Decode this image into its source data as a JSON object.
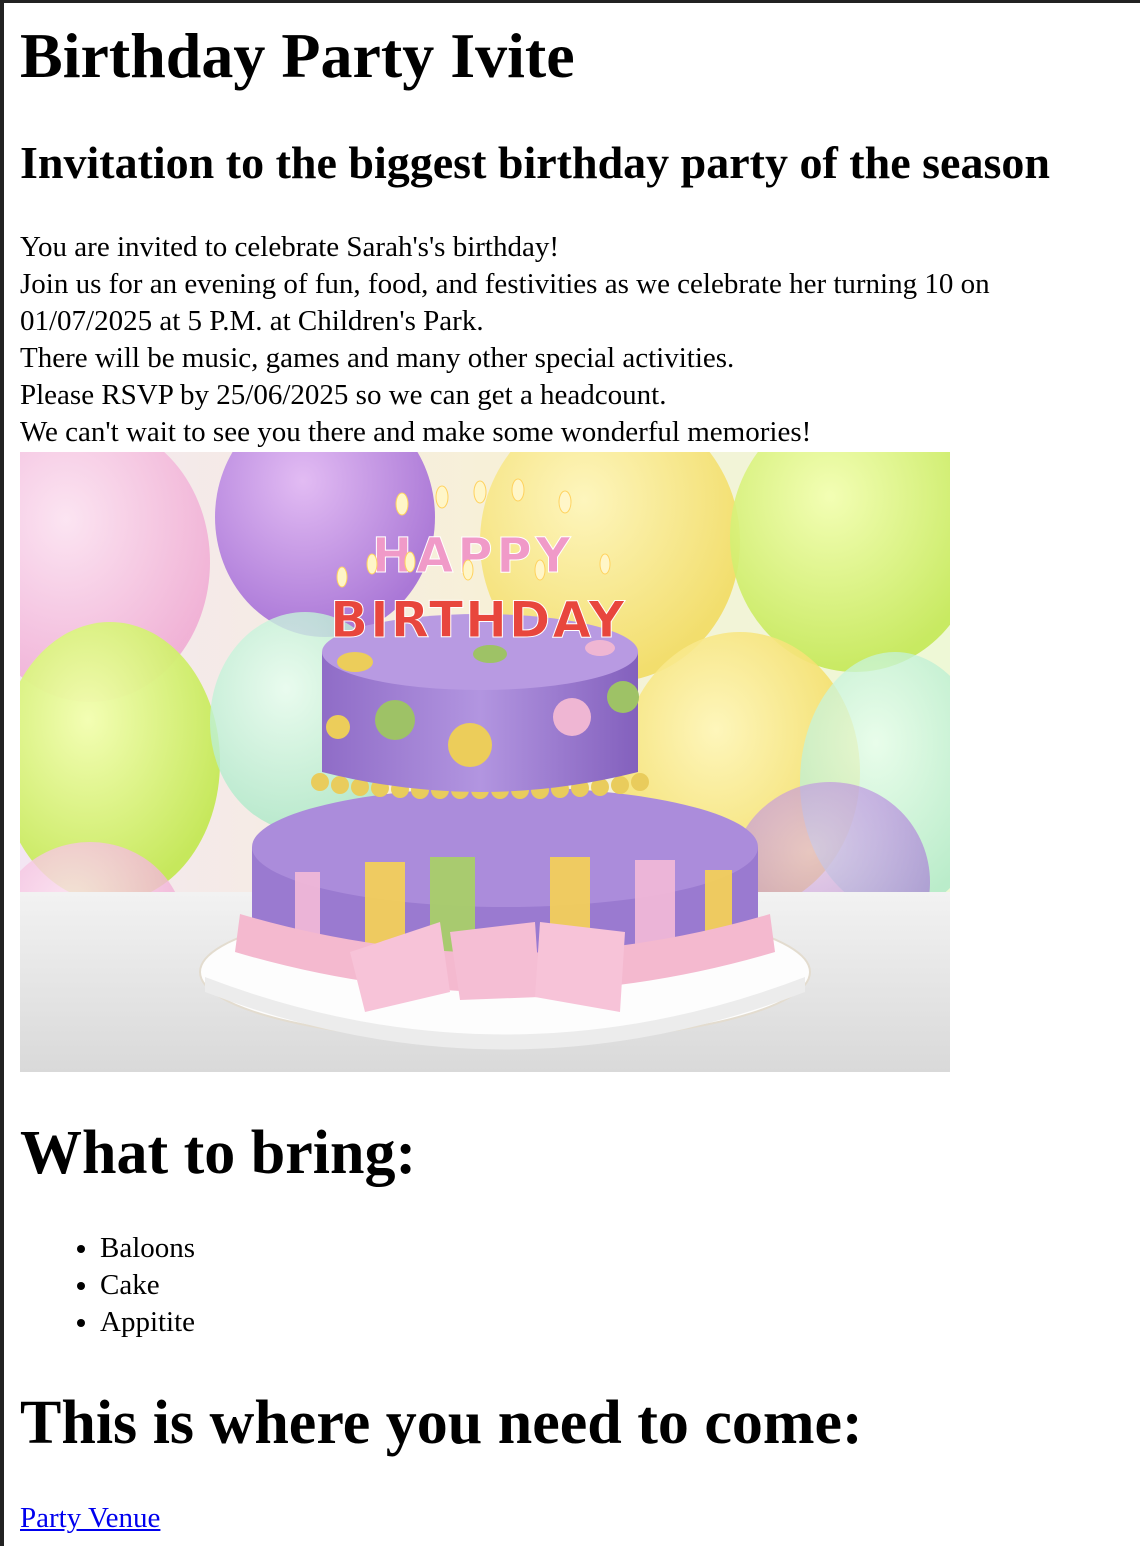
{
  "page": {
    "title": "Birthday Party Ivite",
    "subtitle": "Invitation to the biggest birthday party of the season"
  },
  "intro": {
    "lines": [
      "You are invited to celebrate Sarah's's birthday!",
      "Join us for an evening of fun, food, and festivities as we celebrate her turning 10 on 01/07/2025 at 5 P.M. at Children's Park.",
      "There will be music, games and many other special activities.",
      "Please RSVP by 25/06/2025 so we can get a headcount.",
      "We can't wait to see you there and make some wonderful memories!"
    ]
  },
  "image": {
    "cake_text_top": "HAPPY",
    "cake_text_bottom": "BIRTHDAY"
  },
  "bring": {
    "heading": "What to bring:",
    "items": [
      "Baloons",
      "Cake",
      "Appitite"
    ]
  },
  "venue": {
    "heading": "This is where you need to come:",
    "link_label": "Party Venue"
  }
}
